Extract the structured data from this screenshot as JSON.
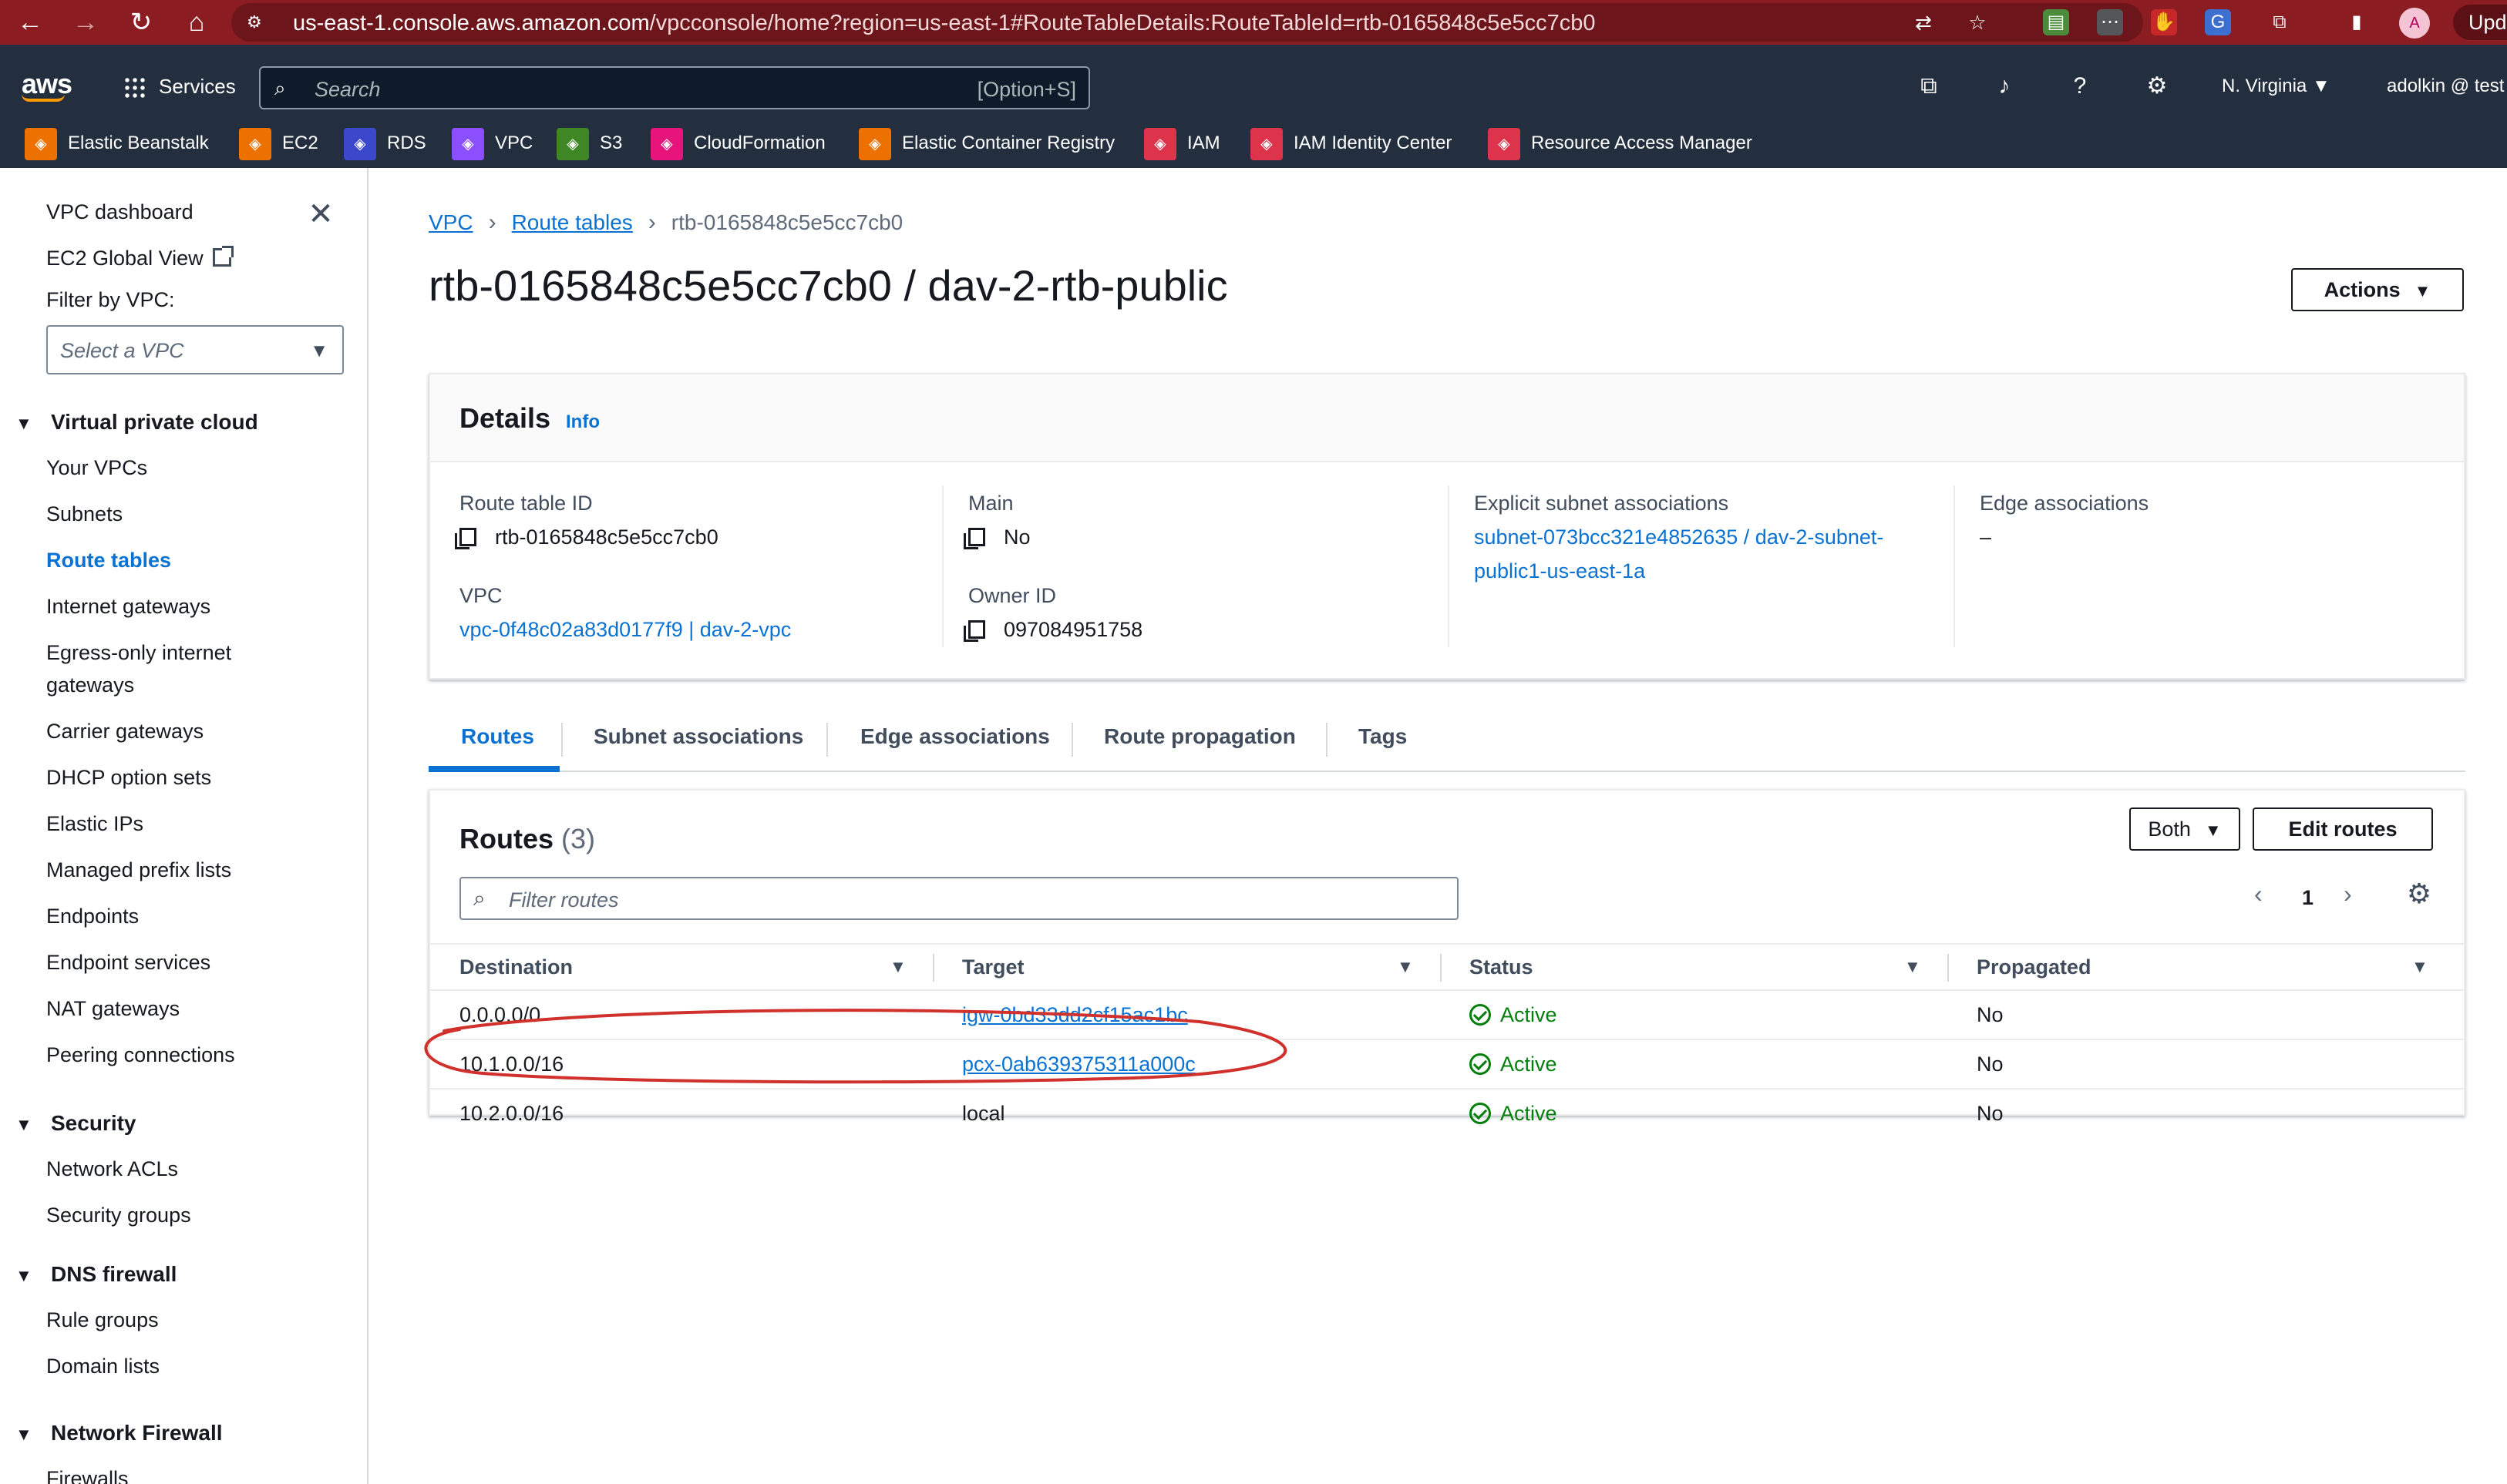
{
  "browser": {
    "url_host": "us-east-1.console.aws.amazon.com",
    "url_path": "/vpcconsole/home?region=us-east-1#RouteTableDetails:RouteTableId=rtb-0165848c5e5cc7cb0",
    "profile_initial": "A",
    "update_label": "Upd"
  },
  "header": {
    "logo": "aws",
    "services_label": "Services",
    "search_placeholder": "Search",
    "search_shortcut": "[Option+S]",
    "region": "N. Virginia",
    "user": "adolkin @ test",
    "favorites": [
      {
        "label": "Elastic Beanstalk",
        "color": "#ed7100"
      },
      {
        "label": "EC2",
        "color": "#ed7100"
      },
      {
        "label": "RDS",
        "color": "#3b48cc"
      },
      {
        "label": "VPC",
        "color": "#8c4fff"
      },
      {
        "label": "S3",
        "color": "#3f8624"
      },
      {
        "label": "CloudFormation",
        "color": "#e7157b"
      },
      {
        "label": "Elastic Container Registry",
        "color": "#ed7100"
      },
      {
        "label": "IAM",
        "color": "#dd344c"
      },
      {
        "label": "IAM Identity Center",
        "color": "#dd344c"
      },
      {
        "label": "Resource Access Manager",
        "color": "#dd344c"
      }
    ]
  },
  "sidebar": {
    "dashboard": "VPC dashboard",
    "ec2_global": "EC2 Global View",
    "filter_label": "Filter by VPC:",
    "select_placeholder": "Select a VPC",
    "sections": [
      {
        "title": "Virtual private cloud",
        "items": [
          "Your VPCs",
          "Subnets",
          "Route tables",
          "Internet gateways",
          "Egress-only internet",
          "gateways",
          "Carrier gateways",
          "DHCP option sets",
          "Elastic IPs",
          "Managed prefix lists",
          "Endpoints",
          "Endpoint services",
          "NAT gateways",
          "Peering connections"
        ]
      },
      {
        "title": "Security",
        "items": [
          "Network ACLs",
          "Security groups"
        ]
      },
      {
        "title": "DNS firewall",
        "items": [
          "Rule groups",
          "Domain lists"
        ]
      },
      {
        "title": "Network Firewall",
        "items": [
          "Firewalls"
        ]
      }
    ]
  },
  "breadcrumb": {
    "items": [
      "VPC",
      "Route tables"
    ],
    "current": "rtb-0165848c5e5cc7cb0"
  },
  "page": {
    "title": "rtb-0165848c5e5cc7cb0 / dav-2-rtb-public",
    "actions_label": "Actions"
  },
  "details": {
    "title": "Details",
    "info": "Info",
    "route_table_id_label": "Route table ID",
    "route_table_id": "rtb-0165848c5e5cc7cb0",
    "vpc_label": "VPC",
    "vpc": "vpc-0f48c02a83d0177f9 | dav-2-vpc",
    "main_label": "Main",
    "main": "No",
    "owner_label": "Owner ID",
    "owner": "097084951758",
    "subnet_label": "Explicit subnet associations",
    "subnet_line1": "subnet-073bcc321e4852635 / dav-2-subnet-",
    "subnet_line2": "public1-us-east-1a",
    "edge_label": "Edge associations",
    "edge": "–"
  },
  "tabs": [
    "Routes",
    "Subnet associations",
    "Edge associations",
    "Route propagation",
    "Tags"
  ],
  "routes": {
    "title": "Routes",
    "count": "(3)",
    "filter_placeholder": "Filter routes",
    "both_label": "Both",
    "edit_label": "Edit routes",
    "page": "1",
    "columns": [
      "Destination",
      "Target",
      "Status",
      "Propagated"
    ],
    "rows": [
      {
        "destination": "0.0.0.0/0",
        "target": "igw-0bd33dd2cf15ac1bc",
        "status": "Active",
        "propagated": "No"
      },
      {
        "destination": "10.1.0.0/16",
        "target": "pcx-0ab639375311a000c",
        "status": "Active",
        "propagated": "No"
      },
      {
        "destination": "10.2.0.0/16",
        "target": "local",
        "status": "Active",
        "propagated": "No"
      }
    ]
  },
  "colors": {
    "browser_bar": "#8a1c22",
    "aws_header": "#232f3e",
    "link": "#0972d3",
    "success": "#037f0c",
    "annotation": "#d0312d"
  }
}
